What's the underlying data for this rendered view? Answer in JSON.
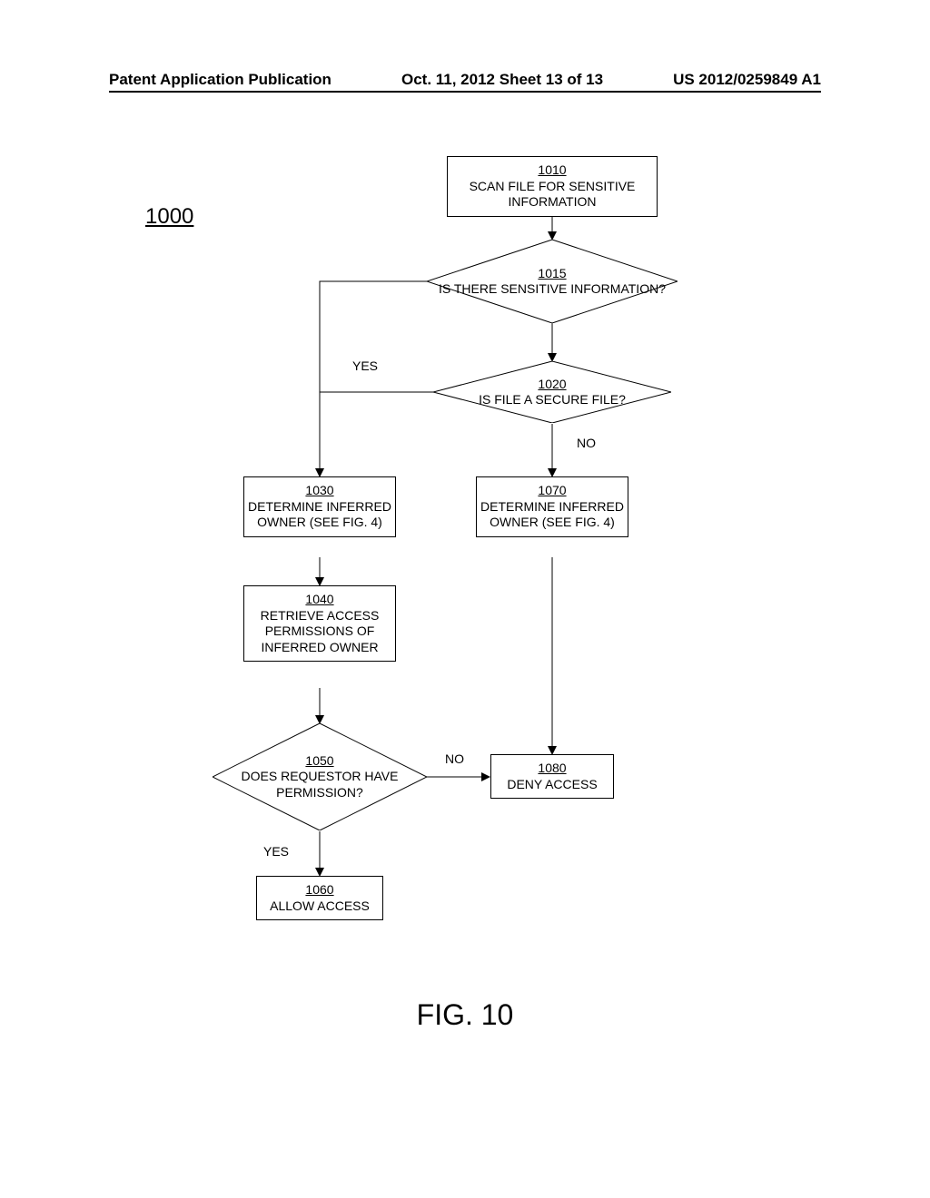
{
  "header": {
    "left": "Patent Application Publication",
    "center": "Oct. 11, 2012  Sheet 13 of 13",
    "right": "US 2012/0259849 A1"
  },
  "figure": {
    "number_label": "1000",
    "title": "FIG. 10",
    "nodes": {
      "n1010": {
        "ref": "1010",
        "text": "SCAN FILE FOR SENSITIVE INFORMATION"
      },
      "n1015": {
        "ref": "1015",
        "text": "IS THERE SENSITIVE INFORMATION?"
      },
      "n1020": {
        "ref": "1020",
        "text": "IS FILE A SECURE FILE?"
      },
      "n1030": {
        "ref": "1030",
        "text": "DETERMINE INFERRED OWNER (SEE FIG. 4)"
      },
      "n1040": {
        "ref": "1040",
        "text": "RETRIEVE ACCESS PERMISSIONS OF INFERRED OWNER"
      },
      "n1050": {
        "ref": "1050",
        "text": "DOES REQUESTOR HAVE PERMISSION?"
      },
      "n1060": {
        "ref": "1060",
        "text": "ALLOW ACCESS"
      },
      "n1070": {
        "ref": "1070",
        "text": "DETERMINE INFERRED OWNER (SEE FIG. 4)"
      },
      "n1080": {
        "ref": "1080",
        "text": "DENY ACCESS"
      }
    },
    "edge_labels": {
      "yes_1020_left": "YES",
      "no_1020_down": "NO",
      "no_1050_right": "NO",
      "yes_1050_down": "YES"
    }
  }
}
